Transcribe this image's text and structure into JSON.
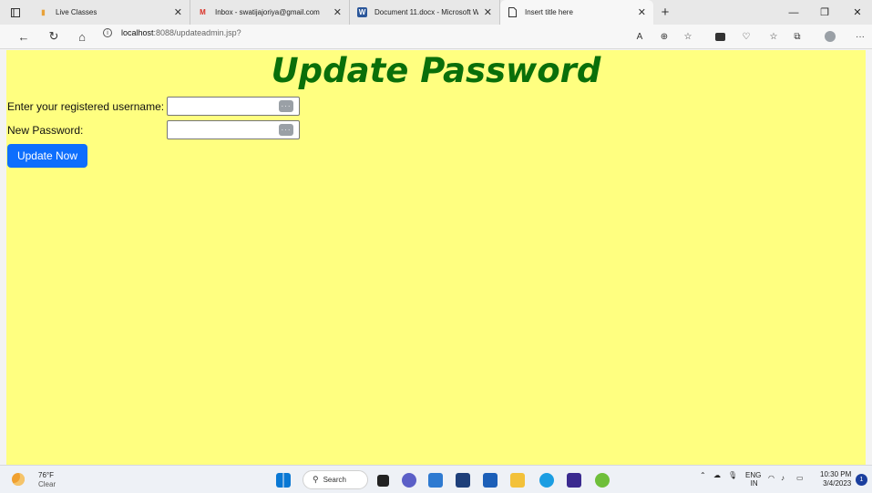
{
  "tabs": [
    {
      "title": "Live Classes",
      "icon": "live-classes-icon"
    },
    {
      "title": "Inbox - swatijajoriya@gmail.com",
      "icon": "gmail-icon"
    },
    {
      "title": "Document 11.docx - Microsoft W",
      "icon": "word-icon"
    },
    {
      "title": "Insert title here",
      "icon": "page-icon"
    }
  ],
  "address": {
    "host": "localhost",
    "path": ":8088/updateadmin.jsp?"
  },
  "page": {
    "heading": "Update Password",
    "username_label": "Enter your registered username:",
    "username_value": "",
    "password_label": "New Password:",
    "password_value": "",
    "submit_label": "Update Now"
  },
  "colors": {
    "page_bg": "#ffff80",
    "heading": "#0a6f0a",
    "button": "#0d6efd"
  },
  "taskbar": {
    "temperature": "76°F",
    "condition": "Clear",
    "search_label": "Search",
    "language": "ENG",
    "region": "IN",
    "time": "10:30 PM",
    "date": "3/4/2023",
    "notifications": "1"
  }
}
